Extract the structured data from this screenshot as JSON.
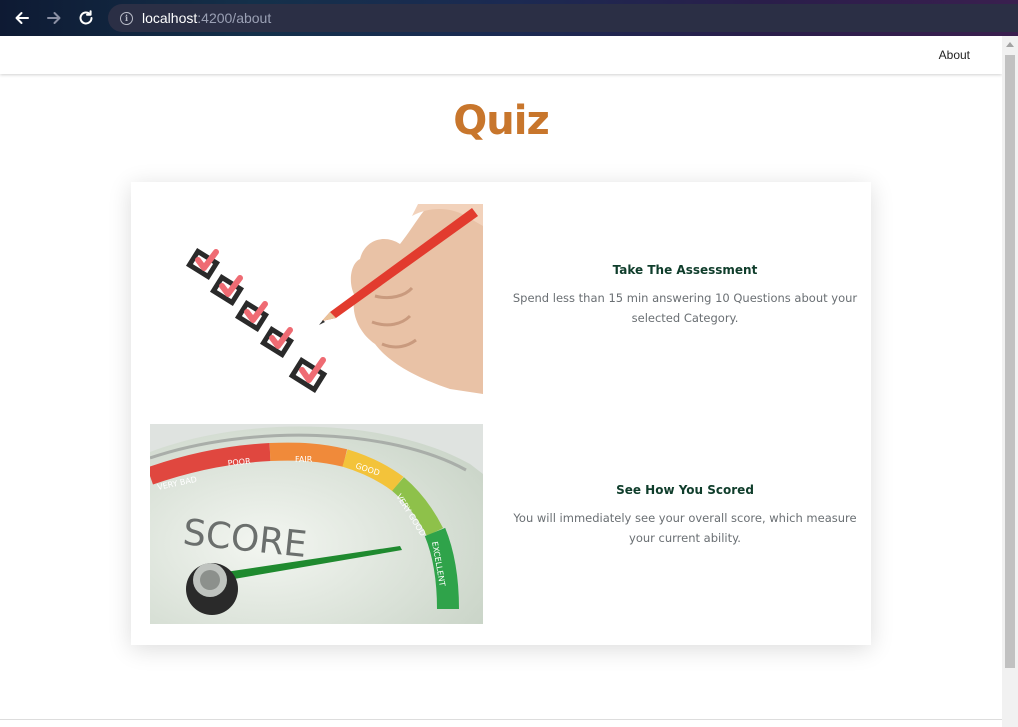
{
  "browser": {
    "url_host": "localhost",
    "url_path": ":4200/about"
  },
  "navbar": {
    "about_label": "About"
  },
  "page": {
    "title": "Quiz"
  },
  "features": [
    {
      "heading": "Take The Assessment",
      "description": "Spend less than 15 min answering 10 Questions about your selected Category.",
      "image": "checklist-image"
    },
    {
      "heading": "See How You Scored",
      "description": "You will immediately see your overall score, which measure your current ability.",
      "image": "score-gauge-image"
    }
  ],
  "gauge": {
    "score_word": "SCORE",
    "labels": [
      "VERY BAD",
      "POOR",
      "FAIR",
      "GOOD",
      "VERY GOOD",
      "EXCELLENT"
    ]
  },
  "colors": {
    "title": "#c8762c",
    "heading": "#0f3d2b",
    "description": "#6a6f73"
  }
}
